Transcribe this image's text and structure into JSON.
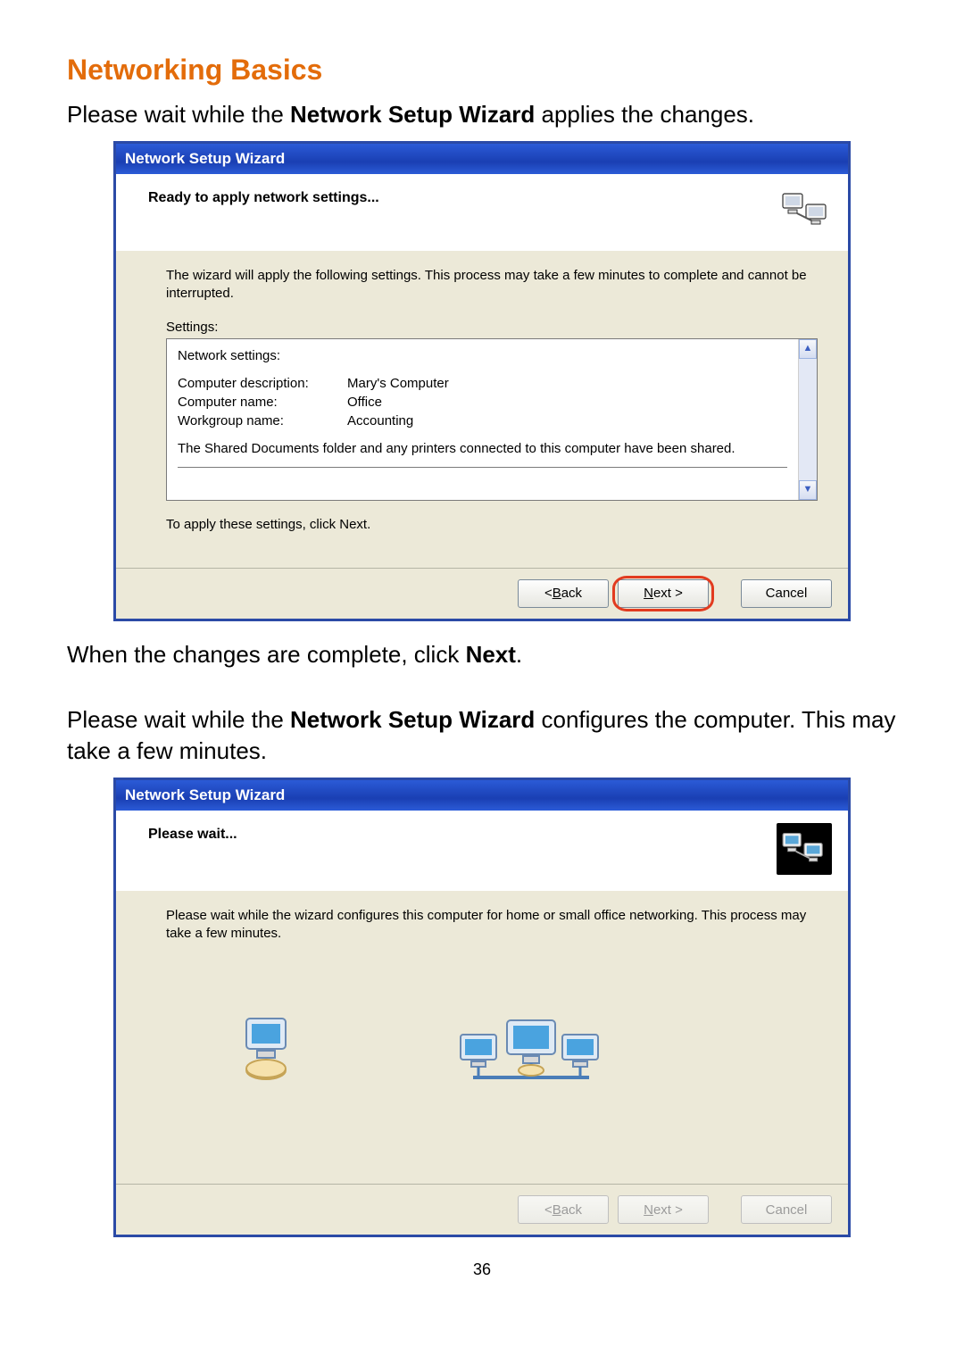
{
  "page": {
    "section_title": "Networking Basics",
    "intro_prefix": "Please wait while the ",
    "intro_bold": "Network Setup Wizard",
    "intro_suffix": " applies the changes.",
    "after_wiz1_prefix": "When the changes are complete, click ",
    "after_wiz1_bold": "Next",
    "after_wiz1_suffix": ".",
    "para2_prefix": "Please wait while the ",
    "para2_bold": "Network Setup Wizard",
    "para2_suffix": " configures the computer. This may take a few minutes.",
    "page_number": "36"
  },
  "wizard1": {
    "title": "Network Setup Wizard",
    "header": "Ready to apply network settings...",
    "intro": "The wizard will apply the following settings. This process may take a few minutes to complete and cannot be interrupted.",
    "settings_label": "Settings:",
    "settings_header": "Network settings:",
    "rows": {
      "k1": "Computer description:",
      "v1": "Mary's Computer",
      "k2": "Computer name:",
      "v2": "Office",
      "k3": "Workgroup name:",
      "v3": "Accounting"
    },
    "shared_note": "The Shared Documents folder and any printers connected to this computer have been shared.",
    "apply_hint": "To apply these settings, click Next.",
    "buttons": {
      "back_pre": "< ",
      "back_u": "B",
      "back_post": "ack",
      "next_u": "N",
      "next_post": "ext >",
      "cancel": "Cancel"
    }
  },
  "wizard2": {
    "title": "Network Setup Wizard",
    "header": "Please wait...",
    "intro": "Please wait while the wizard configures this computer for home or small office networking. This process may take a few minutes.",
    "buttons": {
      "back_pre": "< ",
      "back_u": "B",
      "back_post": "ack",
      "next_u": "N",
      "next_post": "ext >",
      "cancel": "Cancel"
    }
  }
}
